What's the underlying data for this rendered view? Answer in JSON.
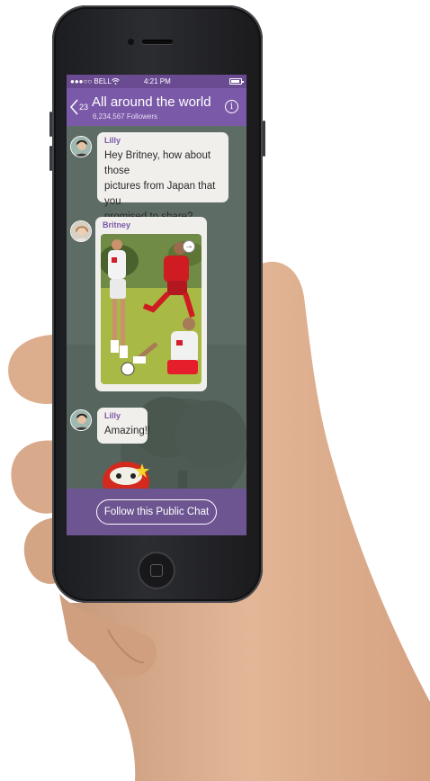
{
  "status_bar": {
    "carrier": "●●●○○ BELL",
    "time": "4:21 PM"
  },
  "header": {
    "back_count": "23",
    "title": "All around the world",
    "followers": "6,234,567 Followers",
    "info_symbol": "i"
  },
  "messages": [
    {
      "sender": "Lilly",
      "lines": [
        "Hey Britney, how about those",
        "pictures from Japan that you",
        "promised to share?"
      ]
    },
    {
      "sender": "Britney",
      "type": "photo"
    },
    {
      "sender": "Lilly",
      "lines": [
        "Amazing!!"
      ]
    }
  ],
  "forward_symbol": "→",
  "footer": {
    "follow_label": "Follow this Public Chat"
  },
  "icons": [
    "back-chevron-icon",
    "info-icon",
    "forward-icon",
    "wifi-icon",
    "battery-icon",
    "sticker"
  ],
  "colors": {
    "header": "#7a59a8",
    "accent": "#7a59a8",
    "chat_bg": "#5c6a63",
    "bubble": "#f1efec"
  }
}
